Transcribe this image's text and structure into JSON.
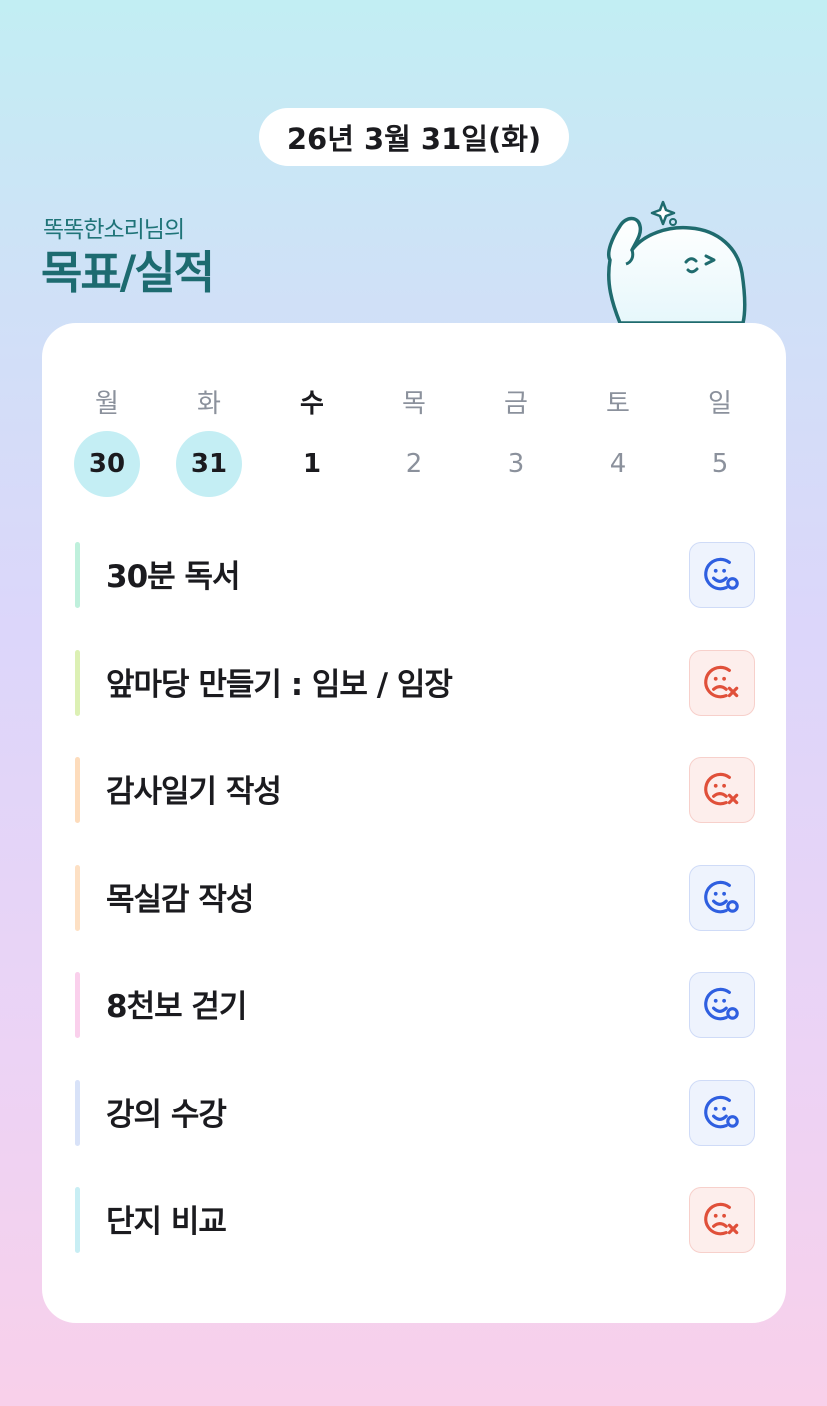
{
  "header": {
    "date": "26년 3월 31일(화)",
    "owner": "똑똑한소리님의",
    "title": "목표/실적"
  },
  "week": {
    "weekdays": [
      "월",
      "화",
      "수",
      "목",
      "금",
      "토",
      "일"
    ],
    "days": [
      "30",
      "31",
      "1",
      "2",
      "3",
      "4",
      "5"
    ],
    "completed_days": [
      "30",
      "31"
    ],
    "today": "1"
  },
  "goals": [
    {
      "label": "30분 독서",
      "status": "success",
      "status_icon": "smile-o-icon",
      "bar_color": "#bff0dc"
    },
    {
      "label": "앞마당 만들기 : 임보 / 임장",
      "status": "fail",
      "status_icon": "sad-x-icon",
      "bar_color": "#dcf0b4"
    },
    {
      "label": "감사일기 작성",
      "status": "fail",
      "status_icon": "sad-x-icon",
      "bar_color": "#fddcbc"
    },
    {
      "label": "목실감 작성",
      "status": "success",
      "status_icon": "smile-o-icon",
      "bar_color": "#fde0c4"
    },
    {
      "label": "8천보 걷기",
      "status": "success",
      "status_icon": "smile-o-icon",
      "bar_color": "#fad0ec"
    },
    {
      "label": "강의 수강",
      "status": "success",
      "status_icon": "smile-o-icon",
      "bar_color": "#d8e2f8"
    },
    {
      "label": "단지 비교",
      "status": "fail",
      "status_icon": "sad-x-icon",
      "bar_color": "#c8eef4"
    }
  ],
  "colors": {
    "success": "#2f5fe0",
    "fail": "#e0503a",
    "title": "#1d6b70",
    "done_day": "#c4eef4"
  }
}
